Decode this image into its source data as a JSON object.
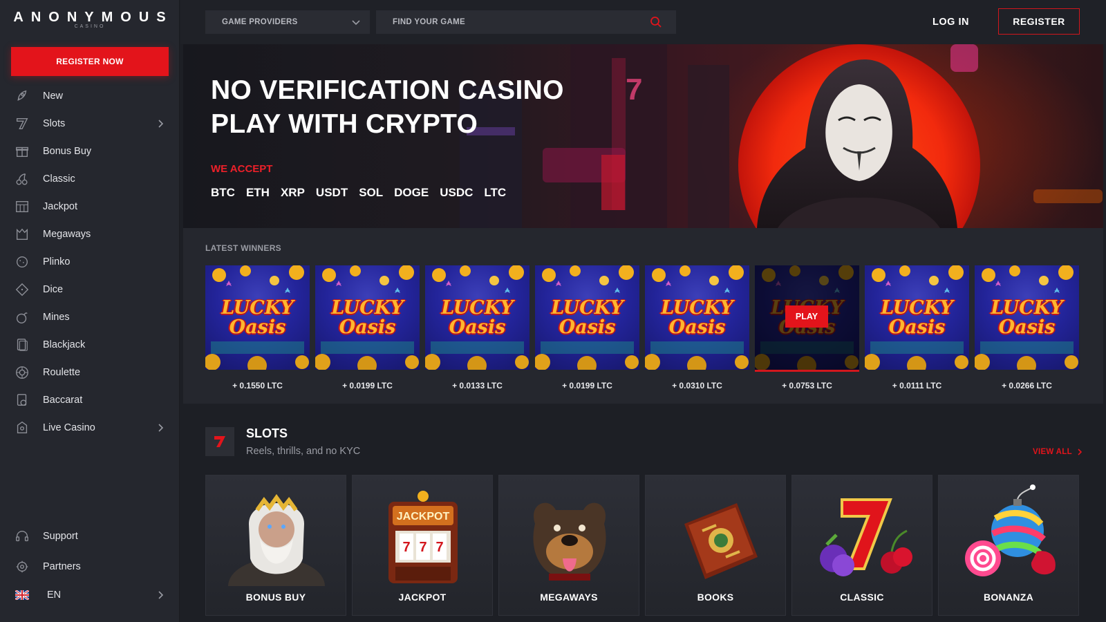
{
  "brand": {
    "name": "ANONYMOUS",
    "sub": "CASINO"
  },
  "sidebar": {
    "register_label": "REGISTER NOW",
    "items": [
      {
        "label": "New",
        "icon": "rocket-icon"
      },
      {
        "label": "Slots",
        "icon": "seven-icon",
        "expandable": true
      },
      {
        "label": "Bonus Buy",
        "icon": "gift-icon"
      },
      {
        "label": "Classic",
        "icon": "cherry-icon"
      },
      {
        "label": "Jackpot",
        "icon": "slot-machine-icon"
      },
      {
        "label": "Megaways",
        "icon": "megaways-icon"
      },
      {
        "label": "Plinko",
        "icon": "plinko-icon"
      },
      {
        "label": "Dice",
        "icon": "dice-icon"
      },
      {
        "label": "Mines",
        "icon": "bomb-icon"
      },
      {
        "label": "Blackjack",
        "icon": "cards-icon"
      },
      {
        "label": "Roulette",
        "icon": "roulette-icon"
      },
      {
        "label": "Baccarat",
        "icon": "baccarat-icon"
      },
      {
        "label": "Live Casino",
        "icon": "live-icon",
        "expandable": true
      }
    ],
    "bottom": [
      {
        "label": "Support",
        "icon": "headset-icon"
      },
      {
        "label": "Partners",
        "icon": "partners-icon"
      }
    ],
    "language": "EN"
  },
  "topbar": {
    "providers_label": "GAME PROVIDERS",
    "search_placeholder": "FIND YOUR GAME",
    "login_label": "LOG IN",
    "register_label": "REGISTER"
  },
  "hero": {
    "title_line1": "NO VERIFICATION CASINO",
    "title_line2": "PLAY WITH CRYPTO",
    "accept_label": "WE ACCEPT",
    "coins": [
      "BTC",
      "ETH",
      "XRP",
      "USDT",
      "SOL",
      "DOGE",
      "USDC",
      "LTC"
    ]
  },
  "winners": {
    "title": "LATEST WINNERS",
    "game_title": "LUCKY Oasis",
    "play_label": "PLAY",
    "items": [
      {
        "amount": "+ 0.1550 LTC"
      },
      {
        "amount": "+ 0.0199 LTC"
      },
      {
        "amount": "+ 0.0133 LTC"
      },
      {
        "amount": "+ 0.0199 LTC"
      },
      {
        "amount": "+ 0.0310 LTC"
      },
      {
        "amount": "+ 0.0753 LTC",
        "hovered": true
      },
      {
        "amount": "+ 0.0111 LTC"
      },
      {
        "amount": "+ 0.0266 LTC"
      }
    ]
  },
  "slots": {
    "title": "SLOTS",
    "subtitle": "Reels, thrills, and no KYC",
    "view_all": "VIEW ALL",
    "categories": [
      {
        "label": "BONUS BUY",
        "art": "zeus-icon"
      },
      {
        "label": "JACKPOT",
        "art": "jackpot-machine-icon",
        "sign": "JACKPOT"
      },
      {
        "label": "MEGAWAYS",
        "art": "dog-icon"
      },
      {
        "label": "BOOKS",
        "art": "book-icon"
      },
      {
        "label": "CLASSIC",
        "art": "seven-fruit-icon"
      },
      {
        "label": "BONANZA",
        "art": "candy-bomb-icon"
      }
    ]
  },
  "colors": {
    "accent": "#e3141b",
    "background": "#1d1f25",
    "panel": "#25272e"
  }
}
